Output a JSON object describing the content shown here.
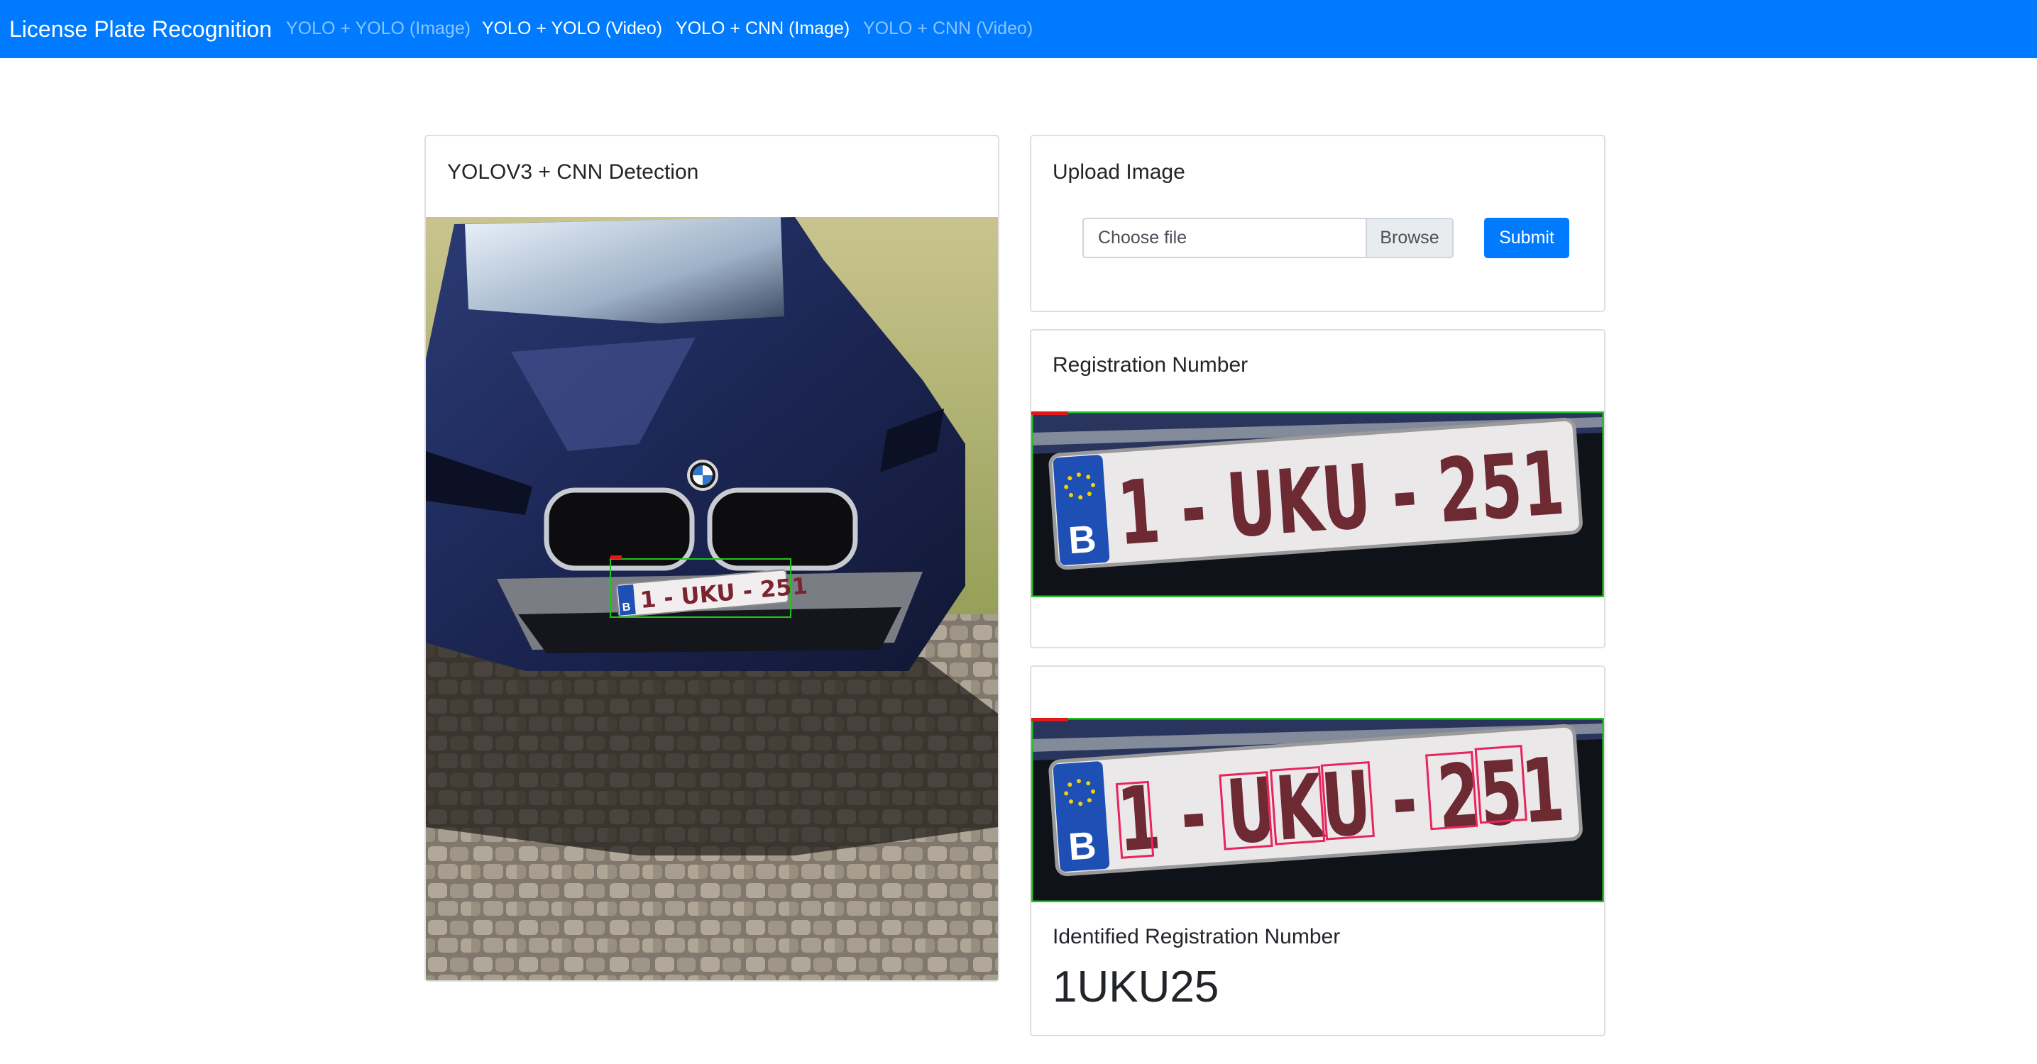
{
  "navbar": {
    "brand": "License Plate Recognition",
    "links": [
      {
        "label": "YOLO + YOLO (Image)",
        "active": false
      },
      {
        "label": "YOLO + YOLO (Video)",
        "active": true
      },
      {
        "label": "YOLO + CNN (Image)",
        "active": true
      },
      {
        "label": "YOLO + CNN (Video)",
        "active": false
      }
    ]
  },
  "detection_card": {
    "title": "YOLOV3 + CNN Detection",
    "plate_text": "1 - UKU - 251",
    "plate_country": "B"
  },
  "upload_card": {
    "title": "Upload Image",
    "file_placeholder": "Choose file",
    "browse_label": "Browse",
    "submit_label": "Submit"
  },
  "registration_card": {
    "title": "Registration Number",
    "plate_text": "1 - UKU - 251",
    "plate_country": "B"
  },
  "segmentation_card": {
    "plate_text": "1 - UKU - 251",
    "plate_country": "B",
    "identified_label": "Identified Registration Number",
    "identified_value": "1UKU25"
  },
  "colors": {
    "navbar": "#007bff",
    "detection_box": "#22c322",
    "char_box": "#e8245c",
    "plate_text": "#7a2430",
    "eu_band": "#1e4fb4"
  },
  "icons": [
    "bmw-logo-icon",
    "eu-stars-icon"
  ]
}
